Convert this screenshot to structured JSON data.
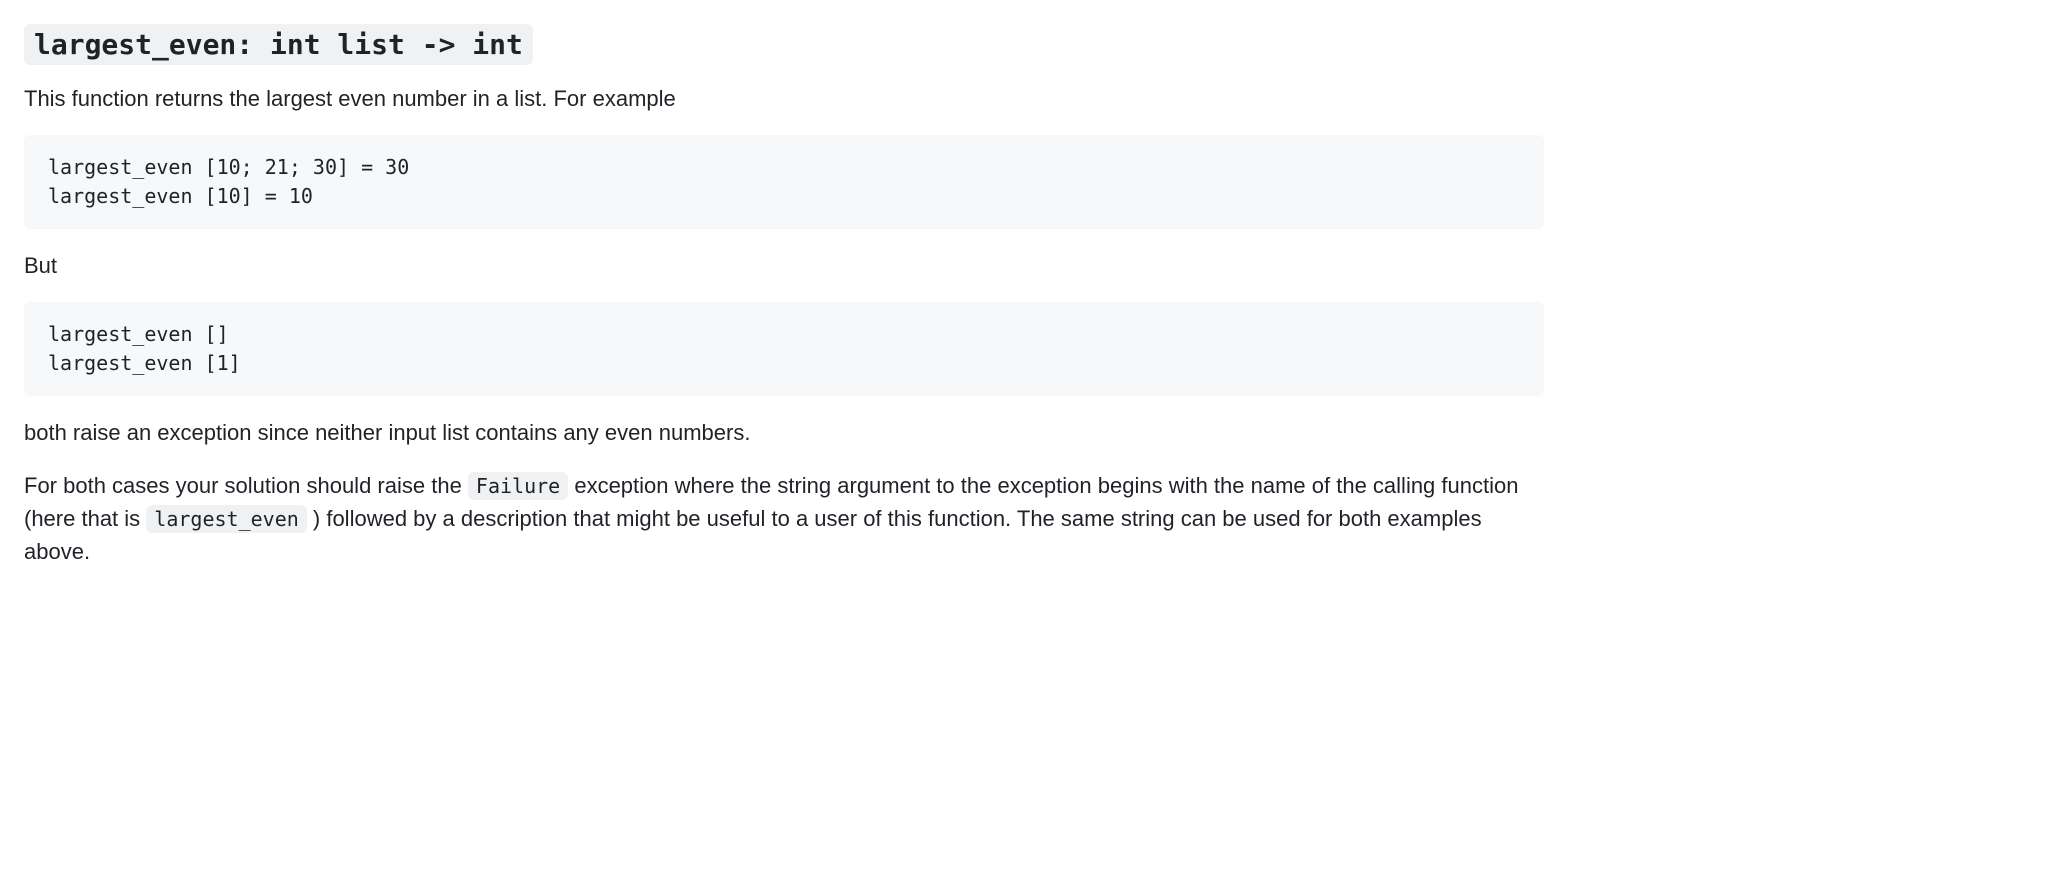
{
  "heading_code": "largest_even: int list -> int",
  "intro": "This function returns the largest even number in a list. For example",
  "code_block_1": "largest_even [10; 21; 30] = 30\nlargest_even [10] = 10",
  "but_text": "But",
  "code_block_2": "largest_even []\nlargest_even [1]",
  "exception_text": "both raise an exception since neither input list contains any even numbers.",
  "final_para": {
    "seg1": "For both cases your solution should raise the ",
    "inline_failure": "Failure",
    "seg2": " exception where the string argument to the exception begins with the name of the calling function (here that is ",
    "inline_largest": "largest_even",
    "seg3": " ) followed by a description that might be useful to a user of this function. The same string can be used for both examples above."
  }
}
